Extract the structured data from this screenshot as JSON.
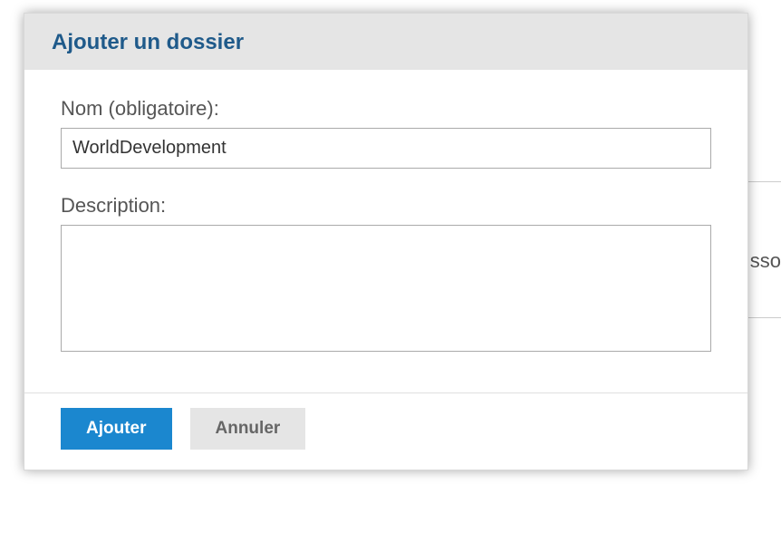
{
  "background": {
    "partial_text": "sso"
  },
  "dialog": {
    "title": "Ajouter un dossier",
    "name_label": "Nom (obligatoire):",
    "name_value": "WorldDevelopment",
    "description_label": "Description:",
    "description_value": "",
    "submit_label": "Ajouter",
    "cancel_label": "Annuler"
  }
}
